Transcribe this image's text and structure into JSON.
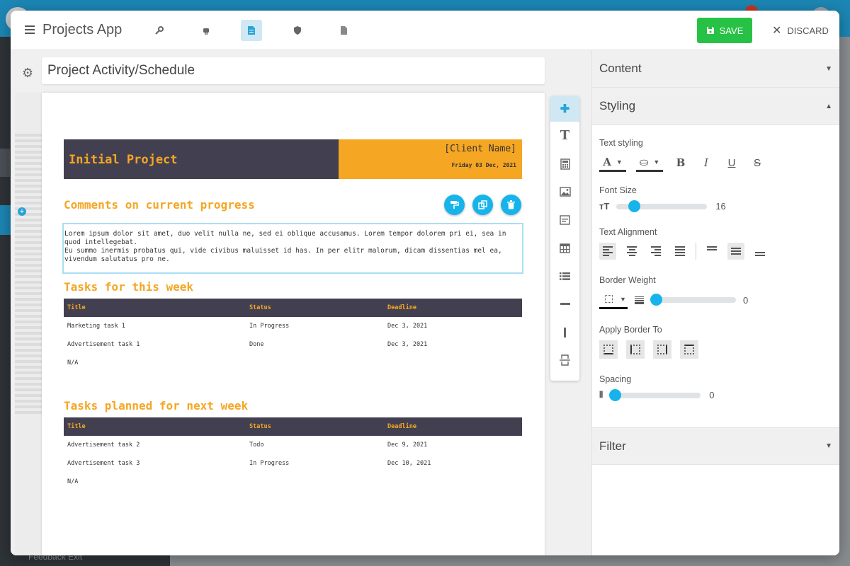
{
  "app": {
    "title": "Projects App",
    "save_label": "SAVE",
    "discard_label": "DISCARD"
  },
  "toolbar_tabs": [
    {
      "name": "wrench-icon",
      "icon": "🔧",
      "active": false
    },
    {
      "name": "robot-icon",
      "icon": "⚙",
      "active": false
    },
    {
      "name": "document-icon",
      "icon": "▤",
      "active": true
    },
    {
      "name": "shield-icon",
      "icon": "◆",
      "active": false
    },
    {
      "name": "file-icon",
      "icon": "▯",
      "active": false
    }
  ],
  "editor": {
    "document_name": "Project Activity/Schedule"
  },
  "report": {
    "project_title": "Initial Project",
    "client_name": "[Client Name]",
    "date": "Friday 03 Dec, 2021",
    "section1_title": "Comments on current progress",
    "comment_text_1": "Lorem ipsum dolor sit amet, duo velit nulla ne, sed ei oblique accusamus. Lorem tempor dolorem pri ei, sea in quod intellegebat.",
    "comment_text_2": "Eu summo inermis probatus qui, vide civibus maluisset id has. In per elitr malorum, dicam dissentias mel ea, vivendum salutatus pro ne.",
    "section2_title": "Tasks for this week",
    "section3_title": "Tasks planned for next week",
    "table_headers": {
      "title": "Title",
      "status": "Status",
      "deadline": "Deadline"
    },
    "this_week": [
      {
        "title": "Marketing task 1",
        "status": "In Progress",
        "deadline": "Dec 3, 2021"
      },
      {
        "title": "Advertisement task 1",
        "status": "Done",
        "deadline": "Dec 3, 2021"
      },
      {
        "title": "N/A",
        "status": "",
        "deadline": ""
      }
    ],
    "next_week": [
      {
        "title": "Advertisement task 2",
        "status": "Todo",
        "deadline": "Dec 9, 2021"
      },
      {
        "title": "Advertisement task 3",
        "status": "In Progress",
        "deadline": "Dec 10, 2021"
      },
      {
        "title": "N/A",
        "status": "",
        "deadline": ""
      }
    ]
  },
  "properties": {
    "content_label": "Content",
    "styling_label": "Styling",
    "filter_label": "Filter",
    "text_styling_label": "Text styling",
    "font_size_label": "Font Size",
    "font_size_value": "16",
    "font_size_fraction": 0.15,
    "text_alignment_label": "Text Alignment",
    "border_weight_label": "Border Weight",
    "border_weight_value": "0",
    "apply_border_label": "Apply Border To",
    "spacing_label": "Spacing",
    "spacing_value": "0"
  },
  "colors": {
    "accent": "#16b4ea",
    "header_dark": "#424050",
    "header_orange": "#f5a623",
    "save_green": "#27c245"
  },
  "background": {
    "footer_text": "Feedback     Exit"
  }
}
